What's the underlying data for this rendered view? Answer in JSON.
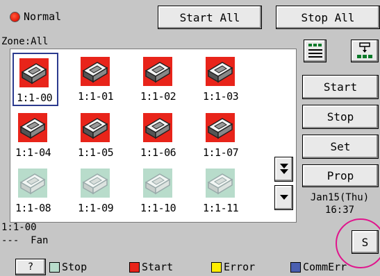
{
  "header": {
    "mode_label": "Normal",
    "start_all": "Start All",
    "stop_all": "Stop All"
  },
  "zone_label": "Zone:All",
  "units": [
    {
      "label": "1:1-00",
      "status": "Start",
      "selected": true
    },
    {
      "label": "1:1-01",
      "status": "Start"
    },
    {
      "label": "1:1-02",
      "status": "Start"
    },
    {
      "label": "1:1-03",
      "status": "Start"
    },
    {
      "label": "1:1-04",
      "status": "Start"
    },
    {
      "label": "1:1-05",
      "status": "Start"
    },
    {
      "label": "1:1-06",
      "status": "Start"
    },
    {
      "label": "1:1-07",
      "status": "Start"
    },
    {
      "label": "1:1-08",
      "status": "Stop"
    },
    {
      "label": "1:1-09",
      "status": "Stop"
    },
    {
      "label": "1:1-10",
      "status": "Stop"
    },
    {
      "label": "1:1-11",
      "status": "Stop"
    }
  ],
  "selected_info": {
    "unit": "1:1-00",
    "detail": "---  Fan"
  },
  "side": {
    "start": "Start",
    "stop": "Stop",
    "set": "Set",
    "prop": "Prop",
    "date": "Jan15(Thu)",
    "time": "16:37",
    "s_button": "S",
    "list_view_icon": "list-view-icon",
    "tree_view_icon": "tree-view-icon"
  },
  "legend": {
    "help": "?",
    "stop": "Stop",
    "start": "Start",
    "error": "Error",
    "commerr": "CommErr"
  },
  "colors": {
    "start": "#e8241a",
    "stop": "#b8dccb",
    "error": "#ffee00",
    "commerr": "#4a5fb0",
    "background": "#c6c6c6"
  }
}
